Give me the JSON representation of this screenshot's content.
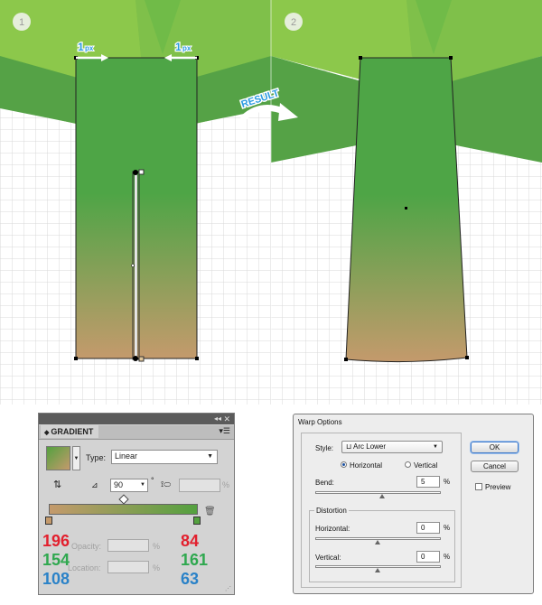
{
  "steps": {
    "step1": "1",
    "step2": "2"
  },
  "annotations": {
    "left_px_value": "1",
    "right_px_value": "1",
    "px_unit": "px",
    "result": "RESULT"
  },
  "gradient_panel": {
    "title": "GRADIENT",
    "type_label": "Type:",
    "type_value": "Linear",
    "angle_value": "90",
    "degree_symbol": "°",
    "opacity_label": "Opacity:",
    "location_label": "Location:",
    "percent": "%",
    "stop_left": {
      "r": "196",
      "g": "154",
      "b": "108",
      "hex": "#c49a6c"
    },
    "stop_right": {
      "r": "84",
      "g": "161",
      "b": "63",
      "hex": "#54a13f"
    }
  },
  "warp_dialog": {
    "title": "Warp Options",
    "style_label": "Style:",
    "style_value": "Arc Lower",
    "horizontal_label": "Horizontal",
    "vertical_label": "Vertical",
    "orientation_selected": "horizontal",
    "bend_label": "Bend:",
    "bend_value": "5",
    "distortion_label": "Distortion",
    "dist_horizontal_label": "Horizontal:",
    "dist_horizontal_value": "0",
    "dist_vertical_label": "Vertical:",
    "dist_vertical_value": "0",
    "percent": "%",
    "ok_label": "OK",
    "cancel_label": "Cancel",
    "preview_label": "Preview",
    "preview_checked": false
  },
  "colors": {
    "background_light_green": "#8cc84b",
    "mid_green": "#7dbd45",
    "band_green": "#55a246",
    "trunk_top": "#4ea546",
    "trunk_bottom": "#c49a6c",
    "accent_blue": "#2a9ae0"
  }
}
